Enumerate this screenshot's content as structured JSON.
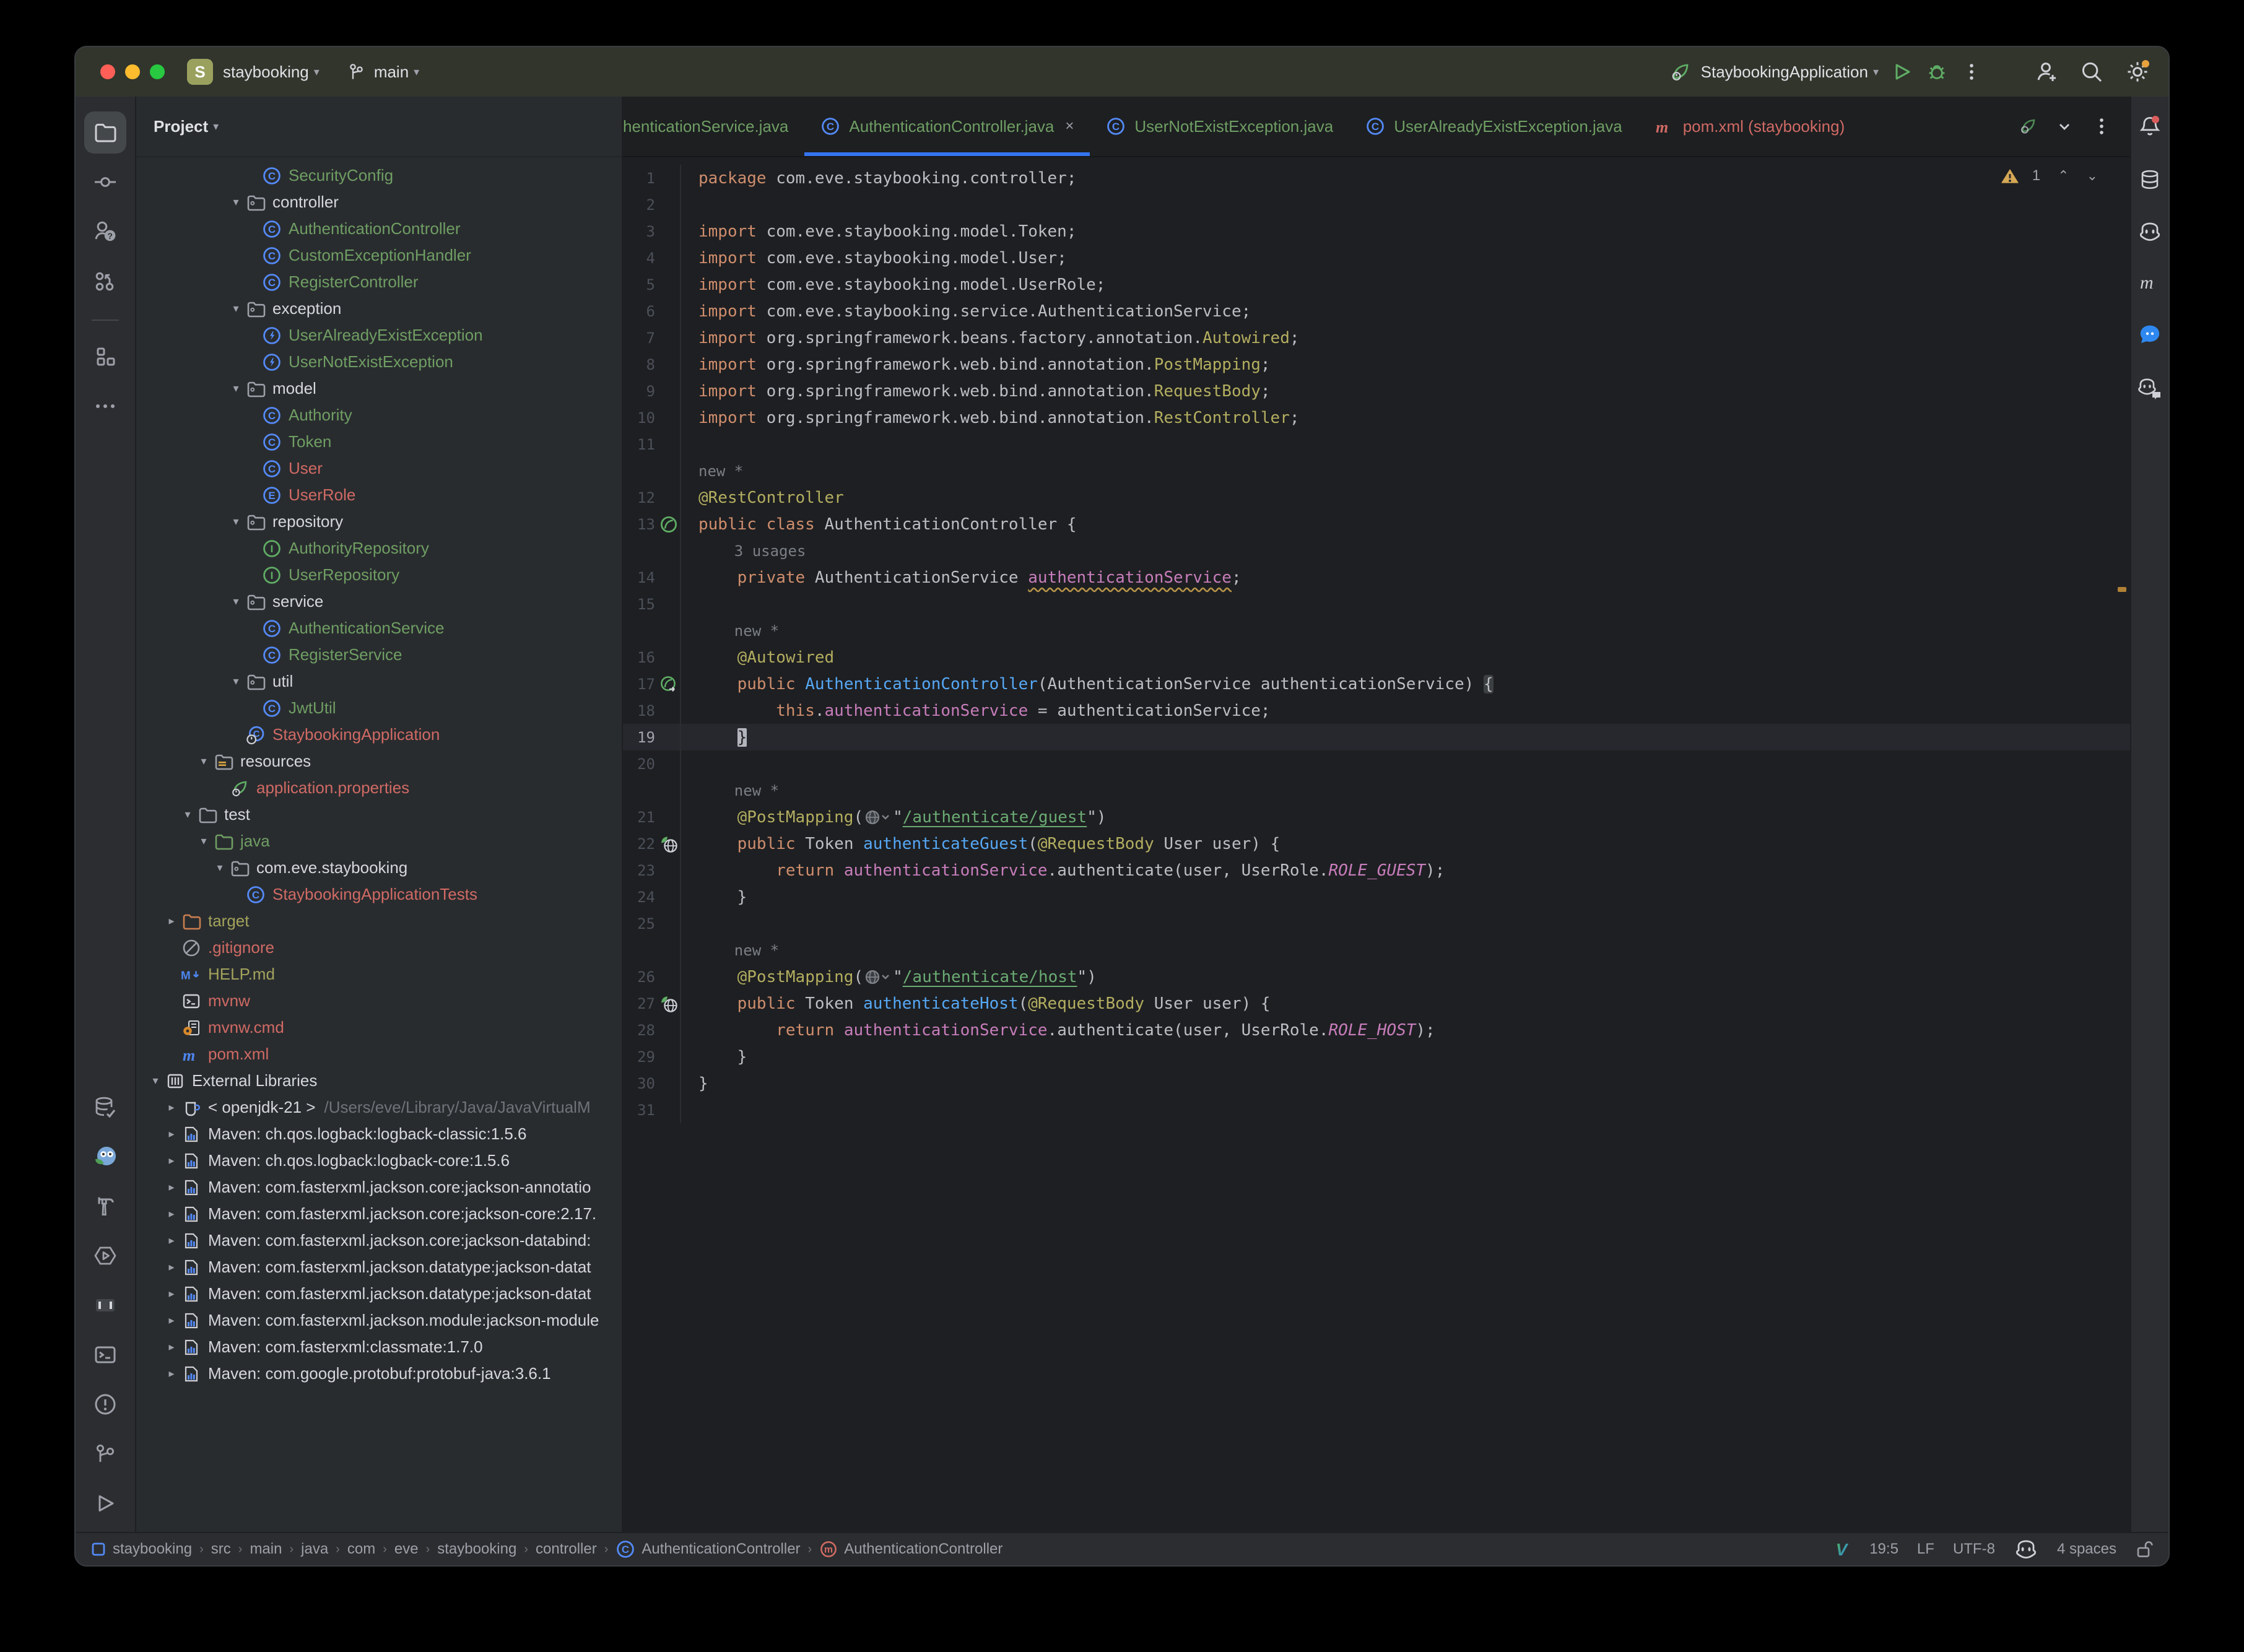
{
  "window": {
    "project_badge": "S",
    "project_name": "staybooking",
    "branch": "main"
  },
  "titlebar": {
    "run_config": "StaybookingApplication",
    "icons_right": [
      "add-user",
      "search",
      "settings-gear"
    ]
  },
  "toolstrip_left": {
    "top": [
      {
        "name": "project-folder",
        "selected": true
      },
      {
        "name": "commit"
      },
      {
        "name": "pull-requests"
      },
      {
        "name": "vcs-graph"
      },
      {
        "name": "divider"
      },
      {
        "name": "structure"
      },
      {
        "name": "more-horizontal"
      }
    ],
    "bottom": [
      {
        "name": "database-check"
      },
      {
        "name": "ai-mascot"
      },
      {
        "name": "build-hammer"
      },
      {
        "name": "profiler"
      },
      {
        "name": "bookmarks-brackets"
      },
      {
        "name": "terminal"
      },
      {
        "name": "problems"
      },
      {
        "name": "git-branch"
      },
      {
        "name": "run-play"
      }
    ]
  },
  "toolstrip_right": [
    {
      "name": "notifications-bell"
    },
    {
      "name": "database"
    },
    {
      "name": "copilot"
    },
    {
      "name": "maven-m"
    },
    {
      "name": "chat-bubble"
    },
    {
      "name": "copilot-chat"
    }
  ],
  "project_panel": {
    "header": "Project",
    "items": [
      {
        "label": "SecurityConfig",
        "level": 6,
        "icon": "class-c",
        "color": "green"
      },
      {
        "label": "controller",
        "level": 5,
        "icon": "package-folder",
        "color": "white",
        "chevron": "down"
      },
      {
        "label": "AuthenticationController",
        "level": 6,
        "icon": "class-c",
        "color": "green",
        "row": "sel"
      },
      {
        "label": "CustomExceptionHandler",
        "level": 6,
        "icon": "class-c",
        "color": "green"
      },
      {
        "label": "RegisterController",
        "level": 6,
        "icon": "class-c",
        "color": "green"
      },
      {
        "label": "exception",
        "level": 5,
        "icon": "package-folder",
        "color": "white",
        "chevron": "down"
      },
      {
        "label": "UserAlreadyExistException",
        "level": 6,
        "icon": "exception-bolt",
        "color": "green"
      },
      {
        "label": "UserNotExistException",
        "level": 6,
        "icon": "exception-bolt",
        "color": "green"
      },
      {
        "label": "model",
        "level": 5,
        "icon": "package-folder",
        "color": "white",
        "chevron": "down"
      },
      {
        "label": "Authority",
        "level": 6,
        "icon": "class-c",
        "color": "green"
      },
      {
        "label": "Token",
        "level": 6,
        "icon": "class-c",
        "color": "green"
      },
      {
        "label": "User",
        "level": 6,
        "icon": "class-c",
        "color": "red"
      },
      {
        "label": "UserRole",
        "level": 6,
        "icon": "enum-e",
        "color": "red"
      },
      {
        "label": "repository",
        "level": 5,
        "icon": "package-folder",
        "color": "white",
        "chevron": "down"
      },
      {
        "label": "AuthorityRepository",
        "level": 6,
        "icon": "interface-i",
        "color": "green"
      },
      {
        "label": "UserRepository",
        "level": 6,
        "icon": "interface-i",
        "color": "green"
      },
      {
        "label": "service",
        "level": 5,
        "icon": "package-folder",
        "color": "white",
        "chevron": "down"
      },
      {
        "label": "AuthenticationService",
        "level": 6,
        "icon": "class-c",
        "color": "green"
      },
      {
        "label": "RegisterService",
        "level": 6,
        "icon": "class-c",
        "color": "green"
      },
      {
        "label": "util",
        "level": 5,
        "icon": "package-folder",
        "color": "white",
        "chevron": "down"
      },
      {
        "label": "JwtUtil",
        "level": 6,
        "icon": "class-c",
        "color": "green"
      },
      {
        "label": "StaybookingApplication",
        "level": 5,
        "icon": "springboot-class",
        "color": "red"
      },
      {
        "label": "resources",
        "level": 3,
        "icon": "resources-folder",
        "color": "white",
        "chevron": "down"
      },
      {
        "label": "application.properties",
        "level": 4,
        "icon": "leaf",
        "color": "red"
      },
      {
        "label": "test",
        "level": 2,
        "icon": "folder",
        "color": "white",
        "chevron": "down"
      },
      {
        "label": "java",
        "level": 3,
        "icon": "folder-green",
        "color": "green",
        "chevron": "down",
        "row": "green"
      },
      {
        "label": "com.eve.staybooking",
        "level": 4,
        "icon": "package-folder",
        "color": "white",
        "chevron": "down",
        "row": "green"
      },
      {
        "label": "StaybookingApplicationTests",
        "level": 5,
        "icon": "class-c",
        "color": "red",
        "row": "green"
      },
      {
        "label": "target",
        "level": 1,
        "icon": "folder-orange",
        "color": "olive",
        "chevron": "right",
        "row": "brown"
      },
      {
        "label": ".gitignore",
        "level": 1,
        "icon": "ignore",
        "color": "red"
      },
      {
        "label": "HELP.md",
        "level": 1,
        "icon": "markdown",
        "color": "olive"
      },
      {
        "label": "mvnw",
        "level": 1,
        "icon": "terminal-file",
        "color": "red"
      },
      {
        "label": "mvnw.cmd",
        "level": 1,
        "icon": "cmd-file",
        "color": "red"
      },
      {
        "label": "pom.xml",
        "level": 1,
        "icon": "maven-m-blue",
        "color": "red"
      },
      {
        "label": "External Libraries",
        "level": 0,
        "icon": "external-lib",
        "color": "white",
        "chevron": "down"
      },
      {
        "label": "< openjdk-21 >",
        "sublabel": "/Users/eve/Library/Java/JavaVirtualM",
        "level": 1,
        "icon": "jdk-cup",
        "color": "white",
        "chevron": "right"
      },
      {
        "label": "Maven: ch.qos.logback:logback-classic:1.5.6",
        "level": 1,
        "icon": "jar-lib",
        "color": "white",
        "chevron": "right"
      },
      {
        "label": "Maven: ch.qos.logback:logback-core:1.5.6",
        "level": 1,
        "icon": "jar-lib",
        "color": "white",
        "chevron": "right"
      },
      {
        "label": "Maven: com.fasterxml.jackson.core:jackson-annotatio",
        "level": 1,
        "icon": "jar-lib",
        "color": "white",
        "chevron": "right"
      },
      {
        "label": "Maven: com.fasterxml.jackson.core:jackson-core:2.17.",
        "level": 1,
        "icon": "jar-lib",
        "color": "white",
        "chevron": "right"
      },
      {
        "label": "Maven: com.fasterxml.jackson.core:jackson-databind:",
        "level": 1,
        "icon": "jar-lib",
        "color": "white",
        "chevron": "right"
      },
      {
        "label": "Maven: com.fasterxml.jackson.datatype:jackson-datat",
        "level": 1,
        "icon": "jar-lib",
        "color": "white",
        "chevron": "right"
      },
      {
        "label": "Maven: com.fasterxml.jackson.datatype:jackson-datat",
        "level": 1,
        "icon": "jar-lib",
        "color": "white",
        "chevron": "right"
      },
      {
        "label": "Maven: com.fasterxml.jackson.module:jackson-module",
        "level": 1,
        "icon": "jar-lib",
        "color": "white",
        "chevron": "right"
      },
      {
        "label": "Maven: com.fasterxml:classmate:1.7.0",
        "level": 1,
        "icon": "jar-lib",
        "color": "white",
        "chevron": "right"
      },
      {
        "label": "Maven: com.google.protobuf:protobuf-java:3.6.1",
        "level": 1,
        "icon": "jar-lib",
        "color": "white",
        "chevron": "right"
      }
    ]
  },
  "tabs": {
    "items": [
      {
        "label": "henticationService.java",
        "color": "green",
        "clipped": true
      },
      {
        "label": "AuthenticationController.java",
        "icon": "class-c",
        "color": "green",
        "active": true,
        "close": "×"
      },
      {
        "label": "UserNotExistException.java",
        "icon": "class-c",
        "color": "green"
      },
      {
        "label": "UserAlreadyExistException.java",
        "icon": "class-c",
        "color": "green"
      },
      {
        "label": "pom.xml (staybooking)",
        "icon": "maven-m-red",
        "color": "red"
      }
    ],
    "controls": [
      "spring-run-small",
      "chevron-down",
      "kebab"
    ]
  },
  "editor": {
    "inspection": {
      "warning_count": "1"
    },
    "rows": [
      {
        "n": "1",
        "t": [
          [
            "k",
            "package "
          ],
          [
            "p",
            "com.eve.staybooking.controller;"
          ]
        ]
      },
      {
        "n": "2",
        "t": []
      },
      {
        "n": "3",
        "t": [
          [
            "k",
            "import "
          ],
          [
            "p",
            "com.eve.staybooking.model.Token;"
          ]
        ]
      },
      {
        "n": "4",
        "t": [
          [
            "k",
            "import "
          ],
          [
            "p",
            "com.eve.staybooking.model.User;"
          ]
        ]
      },
      {
        "n": "5",
        "t": [
          [
            "k",
            "import "
          ],
          [
            "p",
            "com.eve.staybooking.model.UserRole;"
          ]
        ]
      },
      {
        "n": "6",
        "t": [
          [
            "k",
            "import "
          ],
          [
            "p",
            "com.eve.staybooking.service.AuthenticationService;"
          ]
        ]
      },
      {
        "n": "7",
        "t": [
          [
            "k",
            "import "
          ],
          [
            "p",
            "org.springframework.beans.factory.annotation."
          ],
          [
            "a",
            "Autowired"
          ],
          [
            "p",
            ";"
          ]
        ]
      },
      {
        "n": "8",
        "t": [
          [
            "k",
            "import "
          ],
          [
            "p",
            "org.springframework.web.bind.annotation."
          ],
          [
            "a",
            "PostMapping"
          ],
          [
            "p",
            ";"
          ]
        ]
      },
      {
        "n": "9",
        "t": [
          [
            "k",
            "import "
          ],
          [
            "p",
            "org.springframework.web.bind.annotation."
          ],
          [
            "a",
            "RequestBody"
          ],
          [
            "p",
            ";"
          ]
        ]
      },
      {
        "n": "10",
        "t": [
          [
            "k",
            "import "
          ],
          [
            "p",
            "org.springframework.web.bind.annotation."
          ],
          [
            "a",
            "RestController"
          ],
          [
            "p",
            ";"
          ]
        ]
      },
      {
        "n": "11",
        "t": []
      },
      {
        "inlay": "new *",
        "ind": 0
      },
      {
        "n": "12",
        "t": [
          [
            "a",
            "@RestController"
          ]
        ]
      },
      {
        "n": "13",
        "gicon": "spring-bean",
        "t": [
          [
            "k",
            "public class "
          ],
          [
            "p",
            "AuthenticationController {"
          ]
        ]
      },
      {
        "inlay": "3 usages",
        "ind": 4
      },
      {
        "n": "14",
        "t": [
          [
            "p",
            "    "
          ],
          [
            "k",
            "private "
          ],
          [
            "p",
            "AuthenticationService "
          ],
          [
            "fw",
            "authenticationService"
          ],
          [
            "p",
            ";"
          ]
        ]
      },
      {
        "n": "15",
        "t": []
      },
      {
        "inlay": "new *",
        "ind": 4
      },
      {
        "n": "16",
        "t": [
          [
            "p",
            "    "
          ],
          [
            "a",
            "@Autowired"
          ]
        ]
      },
      {
        "n": "17",
        "gicon": "spring-bean-arrow",
        "t": [
          [
            "p",
            "    "
          ],
          [
            "k",
            "public "
          ],
          [
            "m",
            "AuthenticationController"
          ],
          [
            "p",
            "(AuthenticationService authenticationService) "
          ],
          [
            "bh",
            "{"
          ]
        ]
      },
      {
        "n": "18",
        "t": [
          [
            "p",
            "        "
          ],
          [
            "k",
            "this"
          ],
          [
            "p",
            "."
          ],
          [
            "f",
            "authenticationService"
          ],
          [
            "p",
            " = authenticationService;"
          ]
        ]
      },
      {
        "n": "19",
        "cur": true,
        "t": [
          [
            "p",
            "    "
          ],
          [
            "cur",
            "}"
          ]
        ]
      },
      {
        "n": "20",
        "t": []
      },
      {
        "inlay": "new *",
        "ind": 4
      },
      {
        "n": "21",
        "t": [
          [
            "p",
            "    "
          ],
          [
            "a",
            "@PostMapping"
          ],
          [
            "p",
            "("
          ],
          [
            "globe",
            ""
          ],
          [
            "p",
            "\""
          ],
          [
            "s",
            "/authenticate/guest"
          ],
          [
            "p",
            "\")"
          ]
        ]
      },
      {
        "n": "22",
        "gicon": "api-globe",
        "t": [
          [
            "p",
            "    "
          ],
          [
            "k",
            "public "
          ],
          [
            "p",
            "Token "
          ],
          [
            "m",
            "authenticateGuest"
          ],
          [
            "p",
            "("
          ],
          [
            "a",
            "@RequestBody"
          ],
          [
            "p",
            " User user) {"
          ]
        ]
      },
      {
        "n": "23",
        "t": [
          [
            "p",
            "        "
          ],
          [
            "k",
            "return "
          ],
          [
            "f",
            "authenticationService"
          ],
          [
            "p",
            ".authenticate(user, UserRole."
          ],
          [
            "c",
            "ROLE_GUEST"
          ],
          [
            "p",
            ");"
          ]
        ]
      },
      {
        "n": "24",
        "t": [
          [
            "p",
            "    }"
          ]
        ]
      },
      {
        "n": "25",
        "t": []
      },
      {
        "inlay": "new *",
        "ind": 4
      },
      {
        "n": "26",
        "t": [
          [
            "p",
            "    "
          ],
          [
            "a",
            "@PostMapping"
          ],
          [
            "p",
            "("
          ],
          [
            "globe",
            ""
          ],
          [
            "p",
            "\""
          ],
          [
            "s",
            "/authenticate/host"
          ],
          [
            "p",
            "\")"
          ]
        ]
      },
      {
        "n": "27",
        "gicon": "api-globe",
        "t": [
          [
            "p",
            "    "
          ],
          [
            "k",
            "public "
          ],
          [
            "p",
            "Token "
          ],
          [
            "m",
            "authenticateHost"
          ],
          [
            "p",
            "("
          ],
          [
            "a",
            "@RequestBody"
          ],
          [
            "p",
            " User user) {"
          ]
        ]
      },
      {
        "n": "28",
        "t": [
          [
            "p",
            "        "
          ],
          [
            "k",
            "return "
          ],
          [
            "f",
            "authenticationService"
          ],
          [
            "p",
            ".authenticate(user, UserRole."
          ],
          [
            "c",
            "ROLE_HOST"
          ],
          [
            "p",
            ");"
          ]
        ]
      },
      {
        "n": "29",
        "t": [
          [
            "p",
            "    }"
          ]
        ]
      },
      {
        "n": "30",
        "t": [
          [
            "p",
            "}"
          ]
        ]
      },
      {
        "n": "31",
        "t": []
      }
    ]
  },
  "statusbar": {
    "breadcrumbs": [
      {
        "icon": "module-square",
        "label": "staybooking"
      },
      {
        "label": "src"
      },
      {
        "label": "main"
      },
      {
        "label": "java"
      },
      {
        "label": "com"
      },
      {
        "label": "eve"
      },
      {
        "label": "staybooking"
      },
      {
        "label": "controller"
      },
      {
        "icon": "class-c",
        "label": "AuthenticationController"
      },
      {
        "icon": "method-m",
        "label": "AuthenticationController"
      }
    ],
    "right": [
      {
        "icon": "vim-v"
      },
      {
        "label": "19:5"
      },
      {
        "label": "LF"
      },
      {
        "label": "UTF-8"
      },
      {
        "icon": "copilot"
      },
      {
        "label": "4 spaces"
      },
      {
        "icon": "lock-open"
      }
    ]
  },
  "colors": {
    "accent_blue": "#3574f0",
    "vcs_green": "#6f9e63",
    "vcs_red": "#d06a64",
    "vcs_olive": "#a3a35c",
    "warning_orange": "#b08136"
  }
}
